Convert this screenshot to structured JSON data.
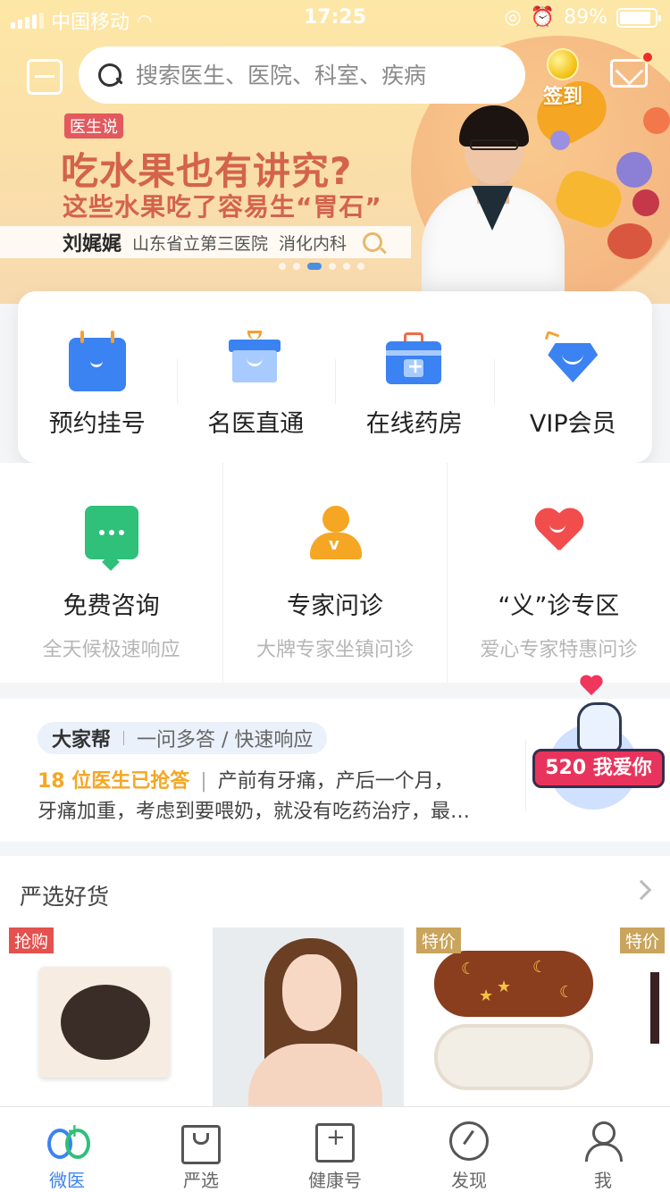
{
  "status_bar": {
    "carrier": "中国移动",
    "time": "17:25",
    "battery": "89%"
  },
  "header": {
    "search_placeholder": "搜索医生、医院、科室、疾病",
    "signin_label": "签到"
  },
  "banner": {
    "tag": "医生说",
    "title": "吃水果也有讲究?",
    "subtitle": "这些水果吃了容易生“胃石”",
    "doctor_name": "刘娓娓",
    "hospital": "山东省立第三医院",
    "department": "消化内科",
    "active_dot": 3,
    "dot_count": 6
  },
  "quick_actions": [
    {
      "label": "预约挂号",
      "icon": "calendar-icon"
    },
    {
      "label": "名医直通",
      "icon": "gift-box-icon"
    },
    {
      "label": "在线药房",
      "icon": "medicine-kit-icon"
    },
    {
      "label": "VIP会员",
      "icon": "diamond-icon"
    }
  ],
  "services": [
    {
      "title": "免费咨询",
      "desc": "全天候极速响应",
      "icon": "chat-bubble-icon"
    },
    {
      "title": "专家问诊",
      "desc": "大牌专家坐镇问诊",
      "icon": "expert-icon"
    },
    {
      "title": "“义”诊专区",
      "desc": "爱心专家特惠问诊",
      "icon": "heart-icon"
    }
  ],
  "community": {
    "name": "大家帮",
    "slogan": "一问多答 / 快速响应",
    "answered": "18 位医生已抢答",
    "question_line1": "产前有牙痛，产后一个月，",
    "question_line2": "牙痛加重，考虑到要喂奶，就没有吃药治疗，最…",
    "promo_badge": "520 我爱你"
  },
  "selection": {
    "title": "严选好货",
    "products": [
      {
        "tag": "抢购",
        "tag_color": "#e4514e"
      },
      {
        "tag": ""
      },
      {
        "tag": "特价",
        "tag_color": "#c9a45c"
      },
      {
        "tag": "特价",
        "tag_color": "#c9a45c"
      }
    ]
  },
  "tabbar": {
    "tabs": [
      {
        "label": "微医",
        "active": true
      },
      {
        "label": "严选",
        "active": false
      },
      {
        "label": "健康号",
        "active": false
      },
      {
        "label": "发现",
        "active": false
      },
      {
        "label": "我",
        "active": false
      }
    ]
  },
  "colors": {
    "accent": "#3b82f2",
    "banner_text": "#d3634c",
    "highlight": "#f5a623"
  }
}
